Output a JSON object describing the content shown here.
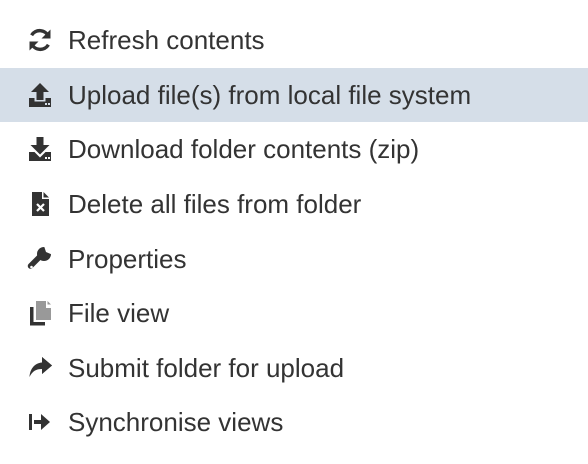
{
  "menu": {
    "items": [
      {
        "label": "Refresh contents",
        "icon": "refresh-icon",
        "active": false
      },
      {
        "label": "Upload file(s) from local file system",
        "icon": "upload-icon",
        "active": true
      },
      {
        "label": "Download folder contents (zip)",
        "icon": "download-icon",
        "active": false
      },
      {
        "label": "Delete all files from folder",
        "icon": "delete-file-icon",
        "active": false
      },
      {
        "label": "Properties",
        "icon": "wrench-icon",
        "active": false
      },
      {
        "label": "File view",
        "icon": "copy-icon",
        "active": false
      },
      {
        "label": "Submit folder for upload",
        "icon": "share-arrow-icon",
        "active": false
      },
      {
        "label": "Synchronise views",
        "icon": "sign-in-icon",
        "active": false
      }
    ],
    "colors": {
      "text": "#333333",
      "highlight": "#d5dee8",
      "background": "#ffffff"
    }
  }
}
